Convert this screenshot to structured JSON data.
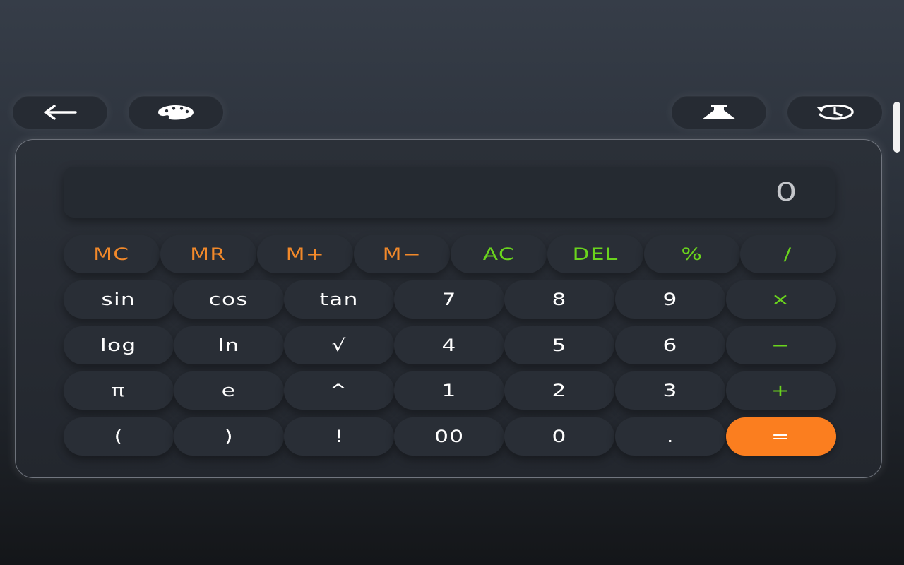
{
  "toolbar": {
    "back_icon": "arrow-left-icon",
    "theme_icon": "palette-icon",
    "scientific_icon": "flask-icon",
    "history_icon": "history-icon"
  },
  "display": {
    "value": "0"
  },
  "keypad": {
    "row1": [
      "MC",
      "MR",
      "M+",
      "M−",
      "AC",
      "DEL",
      "%",
      "/"
    ],
    "row2": [
      "sin",
      "cos",
      "tan",
      "7",
      "8",
      "9",
      "×"
    ],
    "row3": [
      "log",
      "ln",
      "√",
      "4",
      "5",
      "6",
      "−"
    ],
    "row4": [
      "π",
      "e",
      "^",
      "1",
      "2",
      "3",
      "+"
    ],
    "row5": [
      "(",
      ")",
      "!",
      "00",
      "0",
      ".",
      "="
    ]
  },
  "colors": {
    "memory": "#f2892a",
    "operator": "#6ad41d",
    "equals": "#fb7e1f",
    "key_background": "#292e36",
    "text": "#ffffff"
  }
}
